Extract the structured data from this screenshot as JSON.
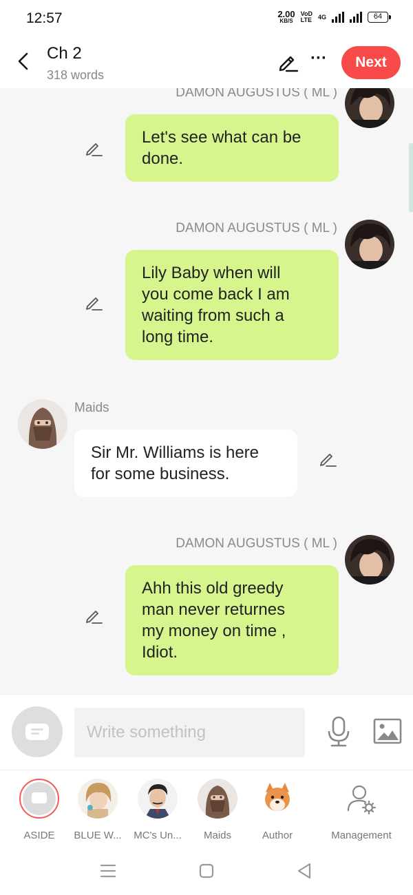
{
  "status_bar": {
    "time": "12:57",
    "net_speed_value": "2.00",
    "net_speed_unit": "KB/S",
    "volte_top": "VoD",
    "volte_bottom": "LTE",
    "signal_tag": "4G",
    "battery": "64"
  },
  "header": {
    "chapter_title": "Ch 2",
    "word_count": "318 words",
    "more_label": "···",
    "next_label": "Next"
  },
  "messages": [
    {
      "speaker": "DAMON AUGUSTUS ( ML )",
      "side": "right",
      "lines": [
        "Let's see what can be",
        "done."
      ]
    },
    {
      "speaker": "DAMON AUGUSTUS ( ML )",
      "side": "right",
      "lines": [
        "Lily Baby when will",
        "you come back I am",
        "waiting from such a",
        "long time."
      ]
    },
    {
      "speaker": "Maids",
      "side": "left",
      "lines": [
        "Sir Mr. Williams is here",
        "for some business."
      ]
    },
    {
      "speaker": "DAMON AUGUSTUS ( ML )",
      "side": "right",
      "lines": [
        "Ahh this old greedy",
        "man never returnes",
        "my money on time ,",
        "Idiot."
      ]
    }
  ],
  "composer": {
    "placeholder": "Write something"
  },
  "characters": [
    {
      "label": "ASIDE"
    },
    {
      "label": "BLUE W..."
    },
    {
      "label": "MC's Un..."
    },
    {
      "label": "Maids"
    },
    {
      "label": "Author"
    },
    {
      "label": "Management"
    }
  ],
  "colors": {
    "accent": "#f94a4a",
    "bubble_self": "#d7f58d",
    "bubble_other": "#ffffff",
    "chat_bg": "#f6f6f6"
  }
}
